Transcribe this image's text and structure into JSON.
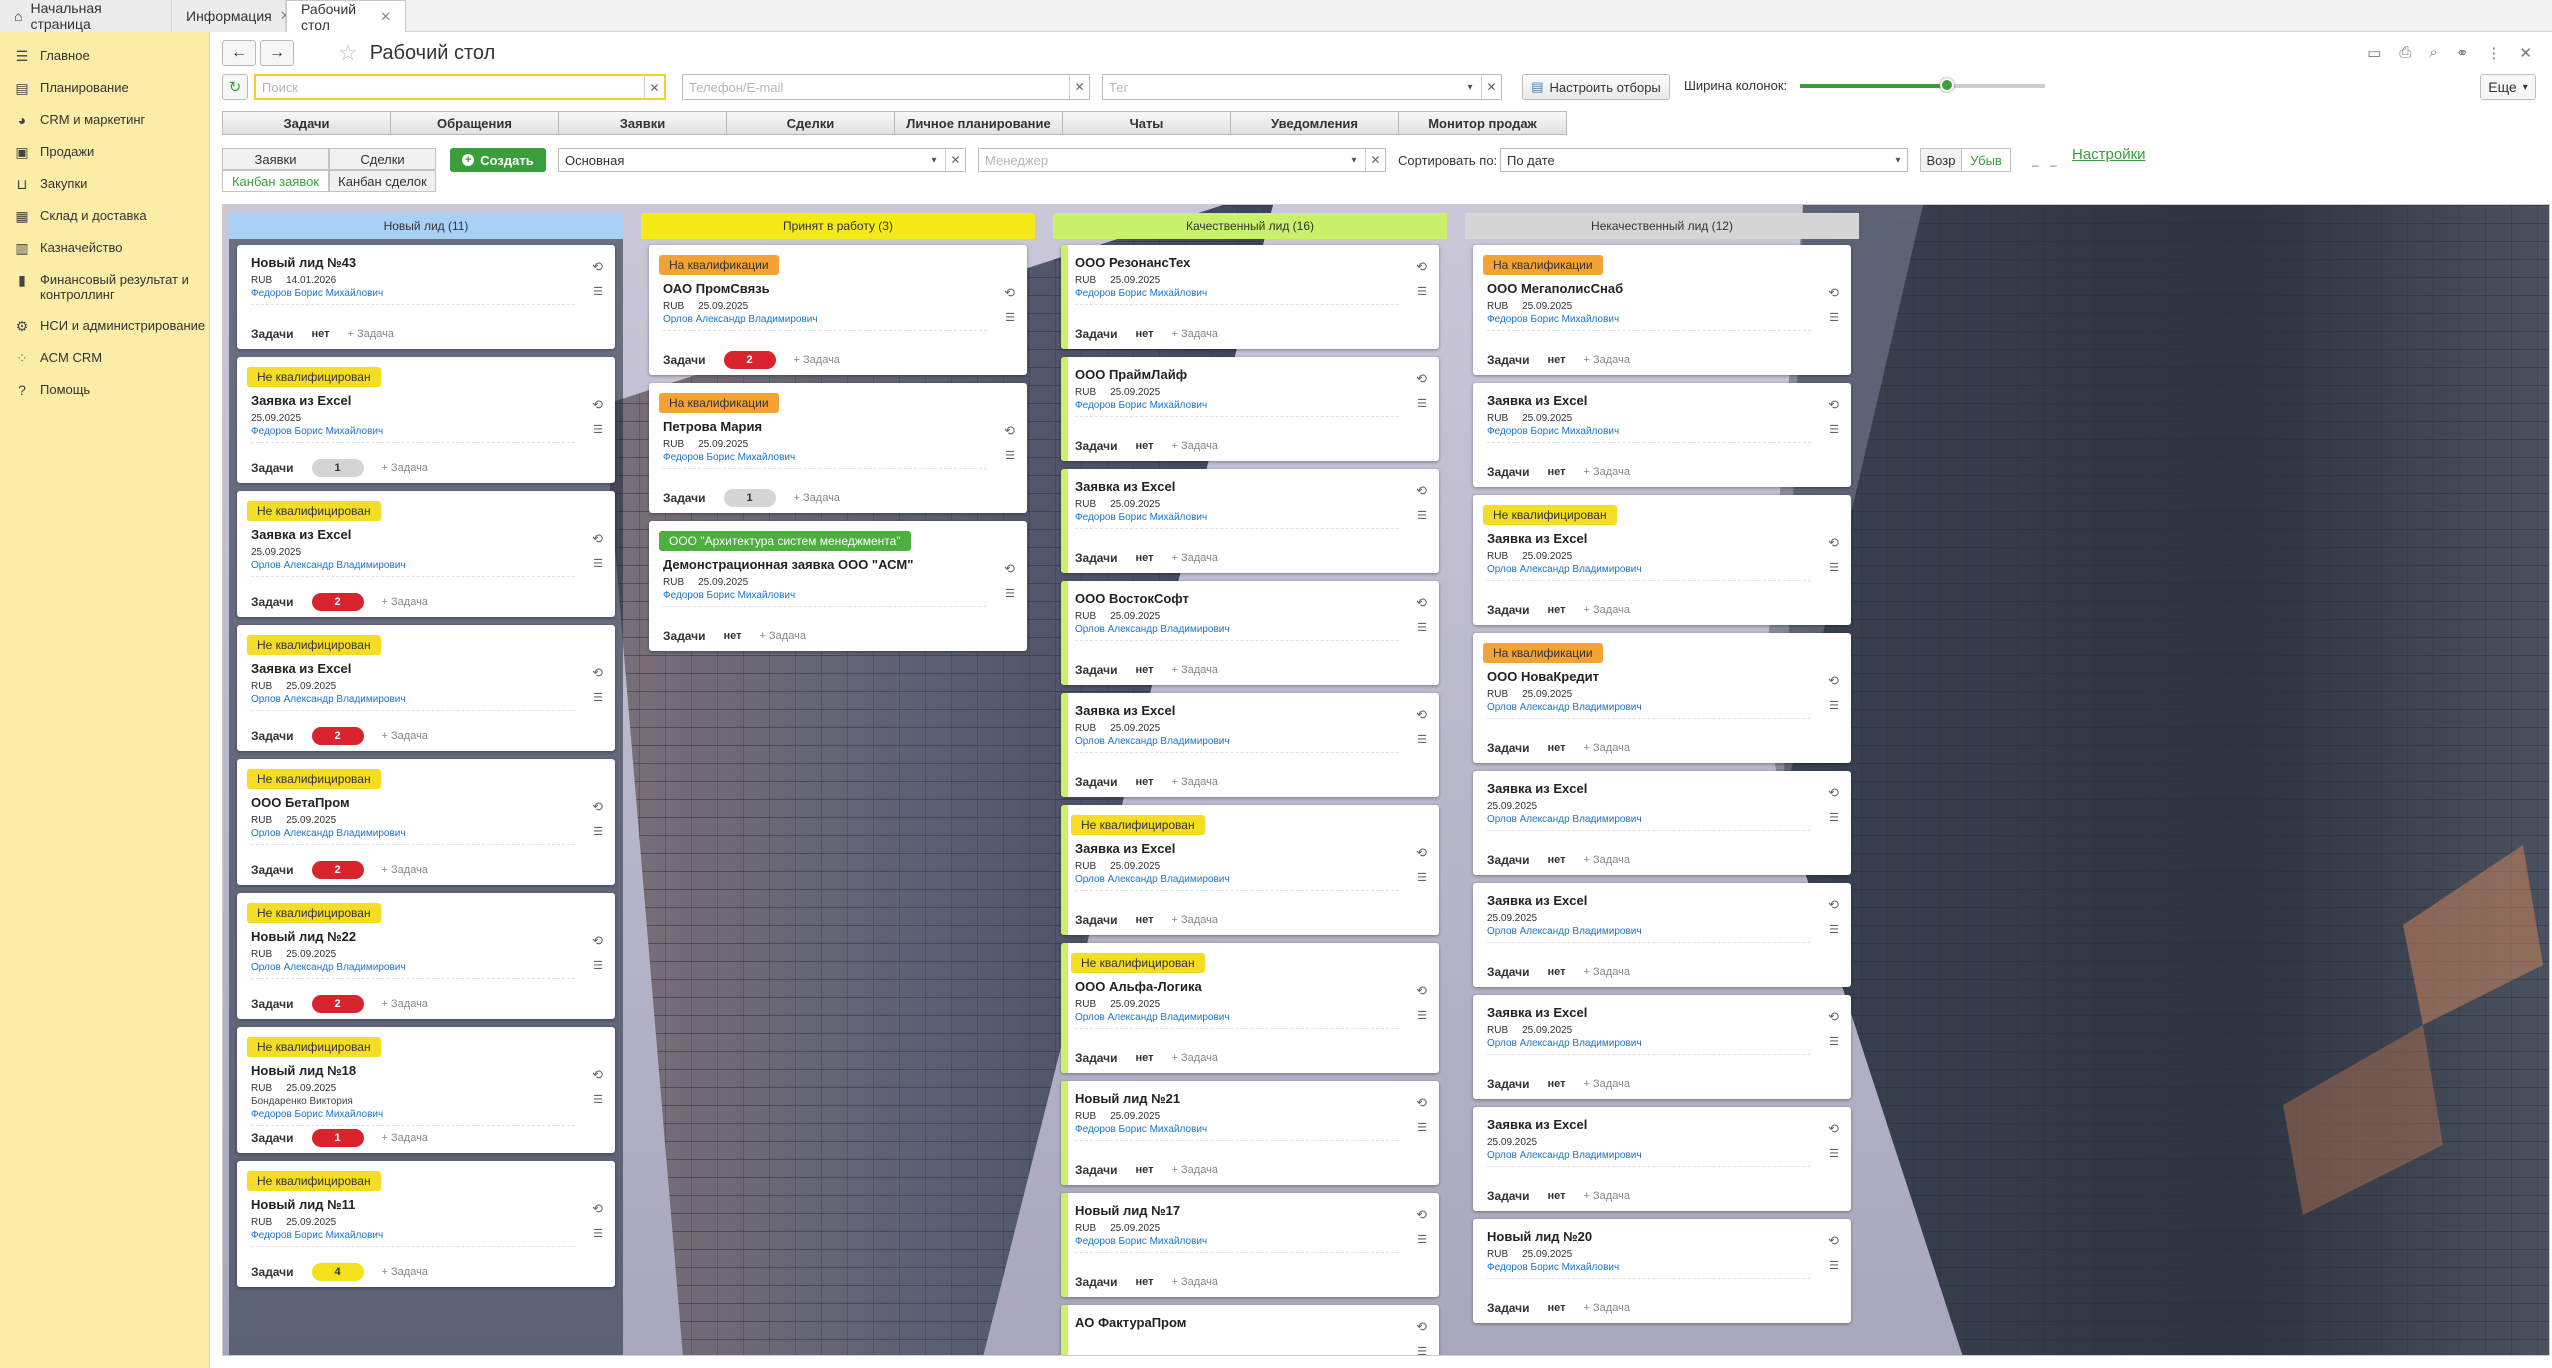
{
  "tabs": [
    {
      "label": "Начальная страница"
    },
    {
      "label": "Информация"
    },
    {
      "label": "Рабочий стол"
    }
  ],
  "sidebar": {
    "items": [
      {
        "label": "Главное",
        "icon": "menu-icon"
      },
      {
        "label": "Планирование",
        "icon": "planning-icon"
      },
      {
        "label": "CRM и маркетинг",
        "icon": "crm-icon"
      },
      {
        "label": "Продажи",
        "icon": "bag-icon"
      },
      {
        "label": "Закупки",
        "icon": "cart-icon"
      },
      {
        "label": "Склад и доставка",
        "icon": "warehouse-icon"
      },
      {
        "label": "Казначейство",
        "icon": "treasury-icon"
      },
      {
        "label": "Финансовый результат и контроллинг",
        "icon": "chart-icon"
      },
      {
        "label": "НСИ и администрирование",
        "icon": "gear-icon"
      },
      {
        "label": "ACM CRM",
        "icon": "grid-icon"
      },
      {
        "label": "Помощь",
        "icon": "help-icon"
      }
    ]
  },
  "header": {
    "title": "Рабочий стол",
    "more_label": "Еще"
  },
  "filters": {
    "search_placeholder": "Поиск",
    "phone_placeholder": "Телефон/E-mail",
    "tag_placeholder": "Тег",
    "setup_filters_label": "Настроить отборы",
    "column_width_label": "Ширина колонок:",
    "column_width_fraction": 0.6
  },
  "main_tabs": [
    "Задачи",
    "Обращения",
    "Заявки",
    "Сделки",
    "Личное планирование",
    "Чаты",
    "Уведомления",
    "Монитор продаж"
  ],
  "view_grid": {
    "top": [
      "Заявки",
      "Сделки"
    ],
    "bottom": [
      "Канбан заявок",
      "Канбан сделок"
    ]
  },
  "toolbar": {
    "create_label": "Создать",
    "scheme_value": "Основная",
    "manager_placeholder": "Менеджер",
    "sort_label": "Сортировать по:",
    "sort_value": "По дате",
    "asc_label": "Возр",
    "desc_label": "Убыв",
    "settings_link": "Настройки"
  },
  "card_common": {
    "tasks_label": "Задачи",
    "add_task_label": "+ Задача",
    "currency": "RUB"
  },
  "columns": [
    {
      "title": "Новый лид (11)",
      "color": "#a9d0f5",
      "bar": "#d7e8f8",
      "cards": [
        {
          "badge": "",
          "title": "Новый лид №43",
          "cur": "RUB",
          "date": "14.01.2026",
          "extra": "",
          "manager": "Федоров Борис Михайлович",
          "tasks": "нет",
          "tasks_style": "none"
        },
        {
          "badge": "Не квалифицирован",
          "title": "Заявка из Excel",
          "cur": "",
          "date": "25.09.2025",
          "extra": "",
          "manager": "Федоров Борис Михайлович",
          "tasks": "1",
          "tasks_style": "gray"
        },
        {
          "badge": "Не квалифицирован",
          "title": "Заявка из Excel",
          "cur": "",
          "date": "25.09.2025",
          "extra": "",
          "manager": "Орлов Александр Владимирович",
          "tasks": "2",
          "tasks_style": "red"
        },
        {
          "badge": "Не квалифицирован",
          "title": "Заявка из Excel",
          "cur": "RUB",
          "date": "25.09.2025",
          "extra": "",
          "manager": "Орлов Александр Владимирович",
          "tasks": "2",
          "tasks_style": "red"
        },
        {
          "badge": "Не квалифицирован",
          "title": "ООО БетаПром",
          "cur": "RUB",
          "date": "25.09.2025",
          "extra": "",
          "manager": "Орлов Александр Владимирович",
          "tasks": "2",
          "tasks_style": "red"
        },
        {
          "badge": "Не квалифицирован",
          "title": "Новый лид №22",
          "cur": "RUB",
          "date": "25.09.2025",
          "extra": "",
          "manager": "Орлов Александр Владимирович",
          "tasks": "2",
          "tasks_style": "red"
        },
        {
          "badge": "Не квалифицирован",
          "title": "Новый лид №18",
          "cur": "RUB",
          "date": "25.09.2025",
          "extra": "Бондаренко Виктория",
          "manager": "Федоров Борис Михайлович",
          "tasks": "1",
          "tasks_style": "red"
        },
        {
          "badge": "Не квалифицирован",
          "title": "Новый лид №11",
          "cur": "RUB",
          "date": "25.09.2025",
          "extra": "",
          "manager": "Федоров Борис Михайлович",
          "tasks": "4",
          "tasks_style": "yellow"
        }
      ]
    },
    {
      "title": "Принят в работу (3)",
      "color": "#f3ea16",
      "bar": "#f3ea16",
      "cards": [
        {
          "badge": "На квалификации",
          "title": "ОАО ПромСвязь",
          "cur": "RUB",
          "date": "25.09.2025",
          "extra": "",
          "manager": "Орлов Александр Владимирович",
          "tasks": "2",
          "tasks_style": "red"
        },
        {
          "badge": "На квалификации",
          "title": "Петрова Мария",
          "cur": "RUB",
          "date": "25.09.2025",
          "extra": "",
          "manager": "Федоров Борис Михайлович",
          "tasks": "1",
          "tasks_style": "gray"
        },
        {
          "badge": "ООО \"Архитектура систем менеджмента\"",
          "title": "Демонстрационная заявка ООО \"АСМ\"",
          "cur": "RUB",
          "date": "25.09.2025",
          "extra": "",
          "manager": "Федоров Борис Михайлович",
          "tasks": "нет",
          "tasks_style": "none"
        }
      ]
    },
    {
      "title": "Качественный лид (16)",
      "color": "#c9f26a",
      "bar": "#c9f26a",
      "cards": [
        {
          "badge": "",
          "title": "ООО РезонансТех",
          "cur": "RUB",
          "date": "25.09.2025",
          "extra": "",
          "manager": "Федоров Борис Михайлович",
          "tasks": "нет",
          "tasks_style": "none"
        },
        {
          "badge": "",
          "title": "ООО ПраймЛайф",
          "cur": "RUB",
          "date": "25.09.2025",
          "extra": "",
          "manager": "Федоров Борис Михайлович",
          "tasks": "нет",
          "tasks_style": "none"
        },
        {
          "badge": "",
          "title": "Заявка из Excel",
          "cur": "RUB",
          "date": "25.09.2025",
          "extra": "",
          "manager": "Федоров Борис Михайлович",
          "tasks": "нет",
          "tasks_style": "none"
        },
        {
          "badge": "",
          "title": "ООО ВостокСофт",
          "cur": "RUB",
          "date": "25.09.2025",
          "extra": "",
          "manager": "Орлов Александр Владимирович",
          "tasks": "нет",
          "tasks_style": "none"
        },
        {
          "badge": "",
          "title": "Заявка из Excel",
          "cur": "RUB",
          "date": "25.09.2025",
          "extra": "",
          "manager": "Орлов Александр Владимирович",
          "tasks": "нет",
          "tasks_style": "none"
        },
        {
          "badge": "Не квалифицирован",
          "title": "Заявка из Excel",
          "cur": "RUB",
          "date": "25.09.2025",
          "extra": "",
          "manager": "Орлов Александр Владимирович",
          "tasks": "нет",
          "tasks_style": "none"
        },
        {
          "badge": "Не квалифицирован",
          "title": "ООО Альфа-Логика",
          "cur": "RUB",
          "date": "25.09.2025",
          "extra": "",
          "manager": "Орлов Александр Владимирович",
          "tasks": "нет",
          "tasks_style": "none"
        },
        {
          "badge": "",
          "title": "Новый лид №21",
          "cur": "RUB",
          "date": "25.09.2025",
          "extra": "",
          "manager": "Федоров Борис Михайлович",
          "tasks": "нет",
          "tasks_style": "none"
        },
        {
          "badge": "",
          "title": "Новый лид №17",
          "cur": "RUB",
          "date": "25.09.2025",
          "extra": "",
          "manager": "Федоров Борис Михайлович",
          "tasks": "нет",
          "tasks_style": "none"
        },
        {
          "badge": "",
          "title": "АО ФактураПром",
          "cur": "",
          "date": "",
          "extra": "",
          "manager": "",
          "tasks": "",
          "tasks_style": "none"
        }
      ]
    },
    {
      "title": "Некачественный лид (12)",
      "color": "#d6d6d6",
      "bar": "#d6d6d6",
      "cards": [
        {
          "badge": "На квалификации",
          "title": "ООО МегаполисСнаб",
          "cur": "RUB",
          "date": "25.09.2025",
          "extra": "",
          "manager": "Федоров Борис Михайлович",
          "tasks": "нет",
          "tasks_style": "none"
        },
        {
          "badge": "",
          "title": "Заявка из Excel",
          "cur": "RUB",
          "date": "25.09.2025",
          "extra": "",
          "manager": "Федоров Борис Михайлович",
          "tasks": "нет",
          "tasks_style": "none"
        },
        {
          "badge": "Не квалифицирован",
          "title": "Заявка из Excel",
          "cur": "RUB",
          "date": "25.09.2025",
          "extra": "",
          "manager": "Орлов Александр Владимирович",
          "tasks": "нет",
          "tasks_style": "none"
        },
        {
          "badge": "На квалификации",
          "title": "ООО НоваКредит",
          "cur": "RUB",
          "date": "25.09.2025",
          "extra": "",
          "manager": "Орлов Александр Владимирович",
          "tasks": "нет",
          "tasks_style": "none"
        },
        {
          "badge": "",
          "title": "Заявка из Excel",
          "cur": "",
          "date": "25.09.2025",
          "extra": "",
          "manager": "Орлов Александр Владимирович",
          "tasks": "нет",
          "tasks_style": "none"
        },
        {
          "badge": "",
          "title": "Заявка из Excel",
          "cur": "",
          "date": "25.09.2025",
          "extra": "",
          "manager": "Орлов Александр Владимирович",
          "tasks": "нет",
          "tasks_style": "none"
        },
        {
          "badge": "",
          "title": "Заявка из Excel",
          "cur": "RUB",
          "date": "25.09.2025",
          "extra": "",
          "manager": "Орлов Александр Владимирович",
          "tasks": "нет",
          "tasks_style": "none"
        },
        {
          "badge": "",
          "title": "Заявка из Excel",
          "cur": "",
          "date": "25.09.2025",
          "extra": "",
          "manager": "Орлов Александр Владимирович",
          "tasks": "нет",
          "tasks_style": "none"
        },
        {
          "badge": "",
          "title": "Новый лид №20",
          "cur": "RUB",
          "date": "25.09.2025",
          "extra": "",
          "manager": "Федоров Борис Михайлович",
          "tasks": "нет",
          "tasks_style": "none"
        }
      ]
    }
  ],
  "badge_colors": {
    "Не квалифицирован": "#f5dc25",
    "На квалификации": "#f4a234",
    "ООО \"Архитектура систем менеджмента\"": "#4caf3e"
  }
}
